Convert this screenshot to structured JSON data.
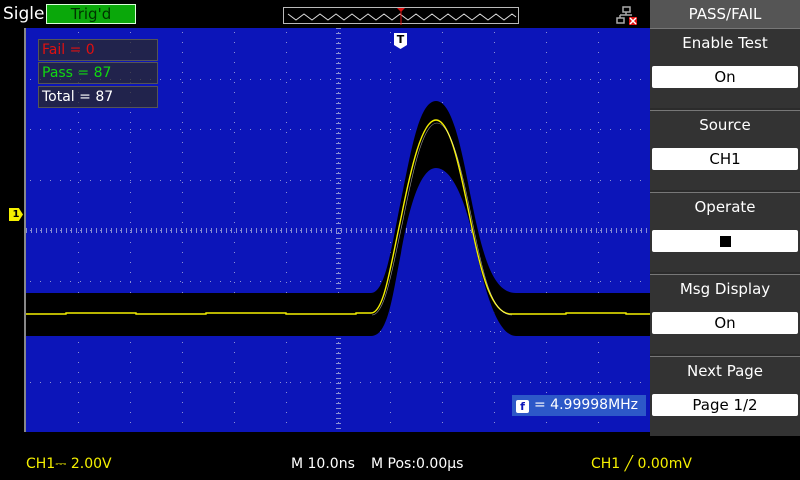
{
  "header": {
    "brand": "Siglent",
    "trigger_status": "Trig'd",
    "usb_icon": "usb-icon"
  },
  "stats": {
    "fail": "Fail = 0",
    "pass": "Pass = 87",
    "total": "Total = 87"
  },
  "markers": {
    "channel": "1",
    "trigger": "T"
  },
  "frequency": {
    "icon_text": "f",
    "value": "= 4.99998MHz"
  },
  "status": {
    "ch1": "CH1⎓ 2.00V",
    "timebase": "M 10.0ns",
    "mpos": "M Pos:0.00µs",
    "trigger": "CH1 ╱ 0.00mV"
  },
  "menu": {
    "title": "PASS/FAIL",
    "items": [
      {
        "label": "Enable Test",
        "value": "On"
      },
      {
        "label": "Source",
        "value": "CH1"
      },
      {
        "label": "Operate",
        "value": ""
      },
      {
        "label": "Msg Display",
        "value": "On"
      },
      {
        "label": "Next Page",
        "value": "Page 1/2"
      }
    ]
  },
  "colors": {
    "screen": "#0c15b9",
    "trace": "#f5f000",
    "mask": "#000000",
    "fail": "#e01010",
    "pass": "#10d810"
  }
}
